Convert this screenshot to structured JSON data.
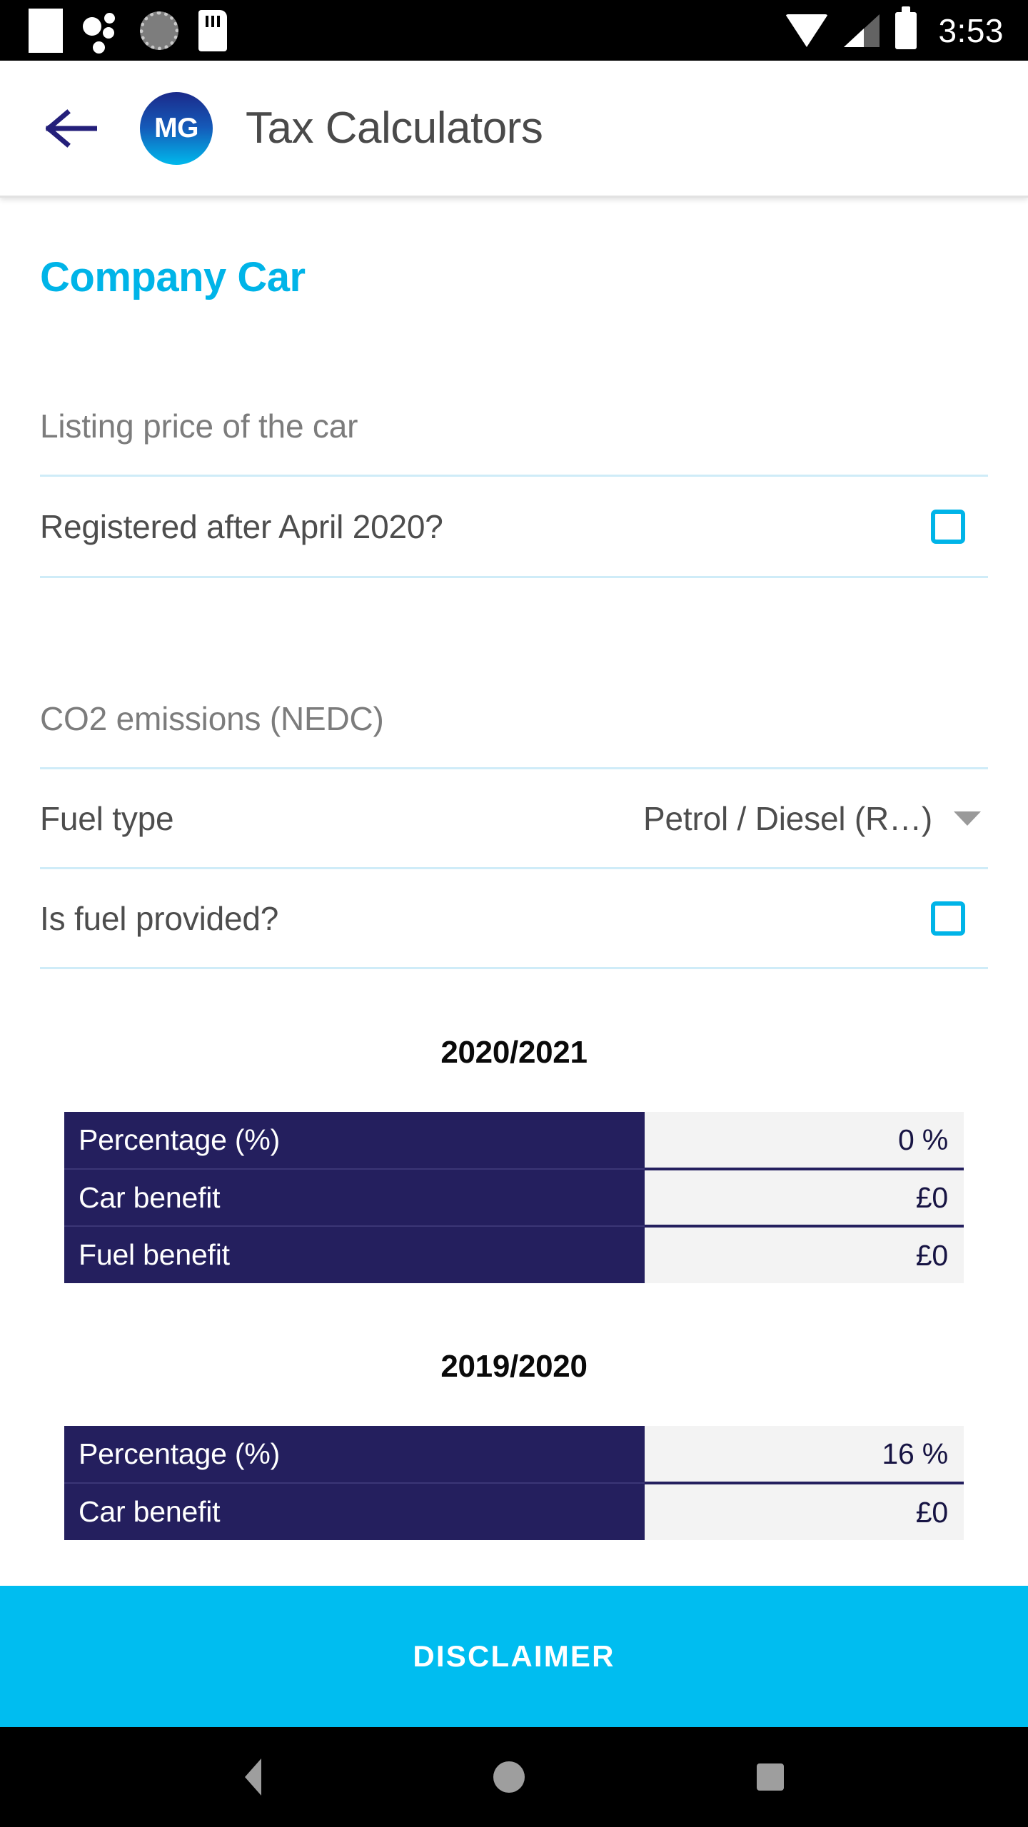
{
  "status_bar": {
    "time": "3:53",
    "icons_left": [
      "screenshot-icon",
      "dots-icon",
      "gear-icon",
      "sd-card-icon"
    ],
    "icons_right": [
      "wifi-icon",
      "signal-icon",
      "battery-icon"
    ]
  },
  "app_bar": {
    "back_icon": "back-arrow-icon",
    "logo_text": "MG",
    "title": "Tax Calculators"
  },
  "page": {
    "section_title": "Company Car"
  },
  "form": {
    "listing_price": {
      "placeholder": "Listing price of the car",
      "value": ""
    },
    "registered_after_2020": {
      "label": "Registered after April 2020?",
      "checked": false
    },
    "co2_emissions": {
      "placeholder": "CO2 emissions (NEDC)",
      "value": ""
    },
    "fuel_type": {
      "label": "Fuel type",
      "value": "Petrol / Diesel (R…)"
    },
    "fuel_provided": {
      "label": "Is fuel provided?",
      "checked": false
    }
  },
  "results": [
    {
      "title": "2020/2021",
      "rows": [
        {
          "label": "Percentage (%)",
          "value": "0 %"
        },
        {
          "label": "Car benefit",
          "value": "£0"
        },
        {
          "label": "Fuel benefit",
          "value": "£0"
        }
      ]
    },
    {
      "title": "2019/2020",
      "rows": [
        {
          "label": "Percentage (%)",
          "value": "16 %"
        },
        {
          "label": "Car benefit",
          "value": "£0"
        }
      ]
    }
  ],
  "footer": {
    "disclaimer_label": "DISCLAIMER"
  },
  "nav_bar": {
    "back": "nav-back-icon",
    "home": "nav-home-icon",
    "recents": "nav-recents-icon"
  },
  "colors": {
    "accent_cyan": "#00b4e8",
    "table_navy": "#241f5e",
    "table_value_bg": "#f3f3f3",
    "divider": "#cfecf8",
    "disclaimer_bg": "#00bdf0"
  }
}
